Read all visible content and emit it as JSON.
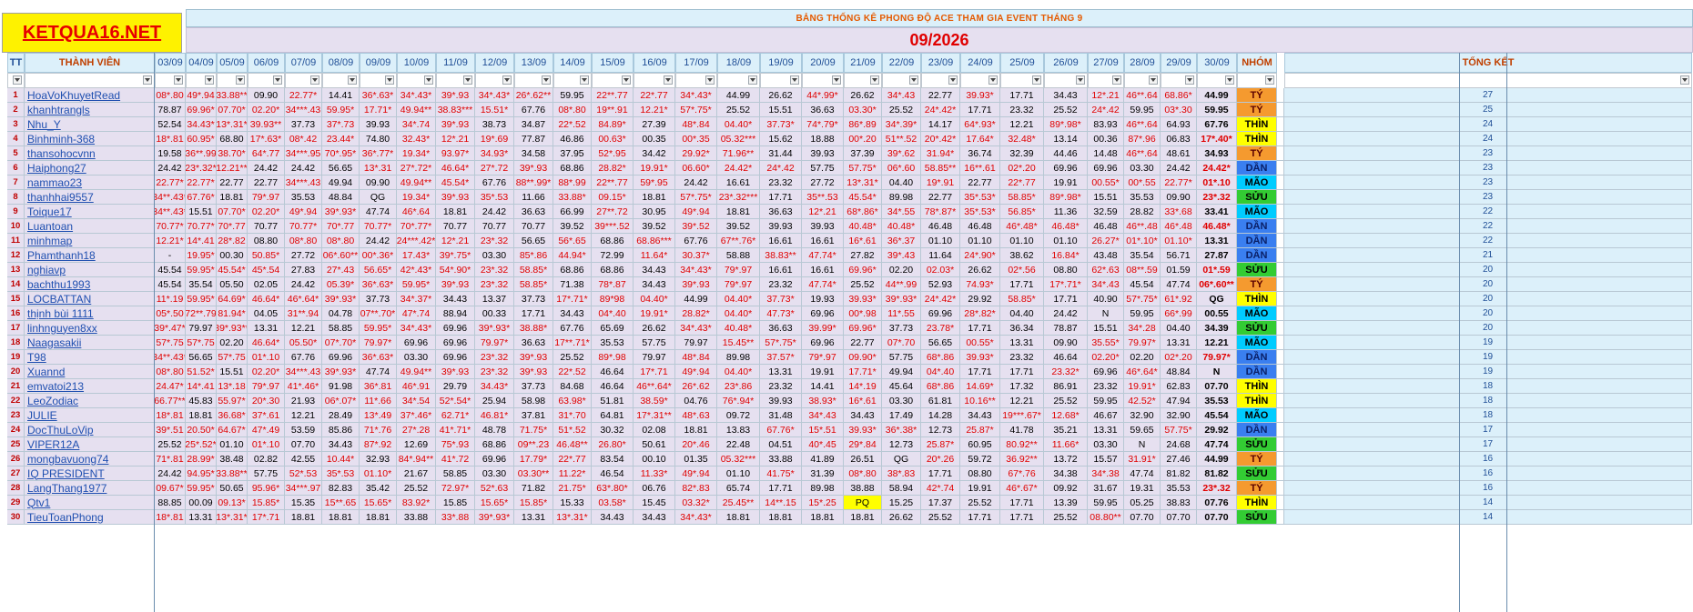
{
  "logo": "KETQUA16.NET",
  "title": "BẢNG THỐNG KÊ PHONG ĐỘ ACE THAM GIA EVENT THÁNG 9",
  "month": "09/2026",
  "headers": {
    "tt": "TT",
    "member": "THÀNH VIÊN",
    "group": "NHÓM",
    "total": "TỔNG KẾT"
  },
  "dates": [
    "03/09",
    "04/09",
    "05/09",
    "06/09",
    "07/09",
    "08/09",
    "09/09",
    "10/09",
    "11/09",
    "12/09",
    "13/09",
    "14/09",
    "15/09",
    "16/09",
    "17/09",
    "18/09",
    "19/09",
    "20/09",
    "21/09",
    "22/09",
    "23/09",
    "24/09",
    "25/09",
    "26/09",
    "27/09",
    "28/09",
    "29/09",
    "30/09"
  ],
  "group_colors": {
    "TÝ": "#f59a2f",
    "THÌN": "#ffff00",
    "DẦN": "#3a7ff0",
    "MÃO": "#00ccff",
    "SỬU": "#33cc33",
    "N": "#ffffff",
    "QG": "#ffffff"
  },
  "rows": [
    {
      "tt": "1",
      "name": "HoaVoKhuyetRead",
      "vals": [
        "08*.80",
        "49*.94",
        "33.88**",
        "09.90",
        "22.77*",
        "14.41",
        "36*.63*",
        "34*.43*",
        "39*.93",
        "34*.43*",
        "26*.62**",
        "59.95",
        "22**.77",
        "22*.77",
        "34*.43*",
        "44.99",
        "26.62",
        "44*.99*",
        "26.62",
        "34*.43",
        "22.77",
        "39.93*",
        "17.71",
        "34.43",
        "12*.21",
        "46**.64",
        "68.86*",
        "44.99"
      ],
      "group": "TÝ",
      "total": "27"
    },
    {
      "tt": "2",
      "name": "khanhtrangls",
      "vals": [
        "78.87",
        "69.96*",
        "07.70*",
        "02.20*",
        "34***.43",
        "59.95*",
        "17.71*",
        "49.94**",
        "38.83***",
        "15.51*",
        "67.76",
        "08*.80",
        "19**.91",
        "12.21*",
        "57*.75*",
        "25.52",
        "15.51",
        "36.63",
        "03.30*",
        "25.52",
        "24*.42*",
        "17.71",
        "23.32",
        "25.52",
        "24*.42",
        "59.95",
        "03*.30",
        "59.95"
      ],
      "group": "TÝ",
      "total": "25"
    },
    {
      "tt": "3",
      "name": "Nhu_Y",
      "vals": [
        "52.54",
        "34.43*",
        "13*.31*",
        "39.93**",
        "37.73",
        "37*.73",
        "39.93",
        "34*.74",
        "39*.93",
        "38.73",
        "34.87",
        "22*.52",
        "84.89*",
        "27.39",
        "48*.84",
        "04.40*",
        "37.73*",
        "74*.79*",
        "86*.89",
        "34*.39*",
        "14.17",
        "64*.93*",
        "12.21",
        "89*.98*",
        "83.93",
        "46**.64",
        "64.93",
        "67.76"
      ],
      "group": "THÌN",
      "total": "24"
    },
    {
      "tt": "4",
      "name": "Binhminh-368",
      "vals": [
        "18*.81",
        "60.95*",
        "68.80",
        "17*.63*",
        "08*.42",
        "23.44*",
        "74.80",
        "32.43*",
        "12*.21",
        "19*.69",
        "77.87",
        "46.86",
        "00.63*",
        "00.35",
        "00*.35",
        "05.32***",
        "15.62",
        "18.88",
        "00*.20",
        "51**.52",
        "20*.42*",
        "17.64*",
        "32.48*",
        "13.14",
        "00.36",
        "87*.96",
        "06.83",
        "17*.40*"
      ],
      "group": "THÌN",
      "total": "24"
    },
    {
      "tt": "5",
      "name": "thansohocvnn",
      "vals": [
        "19.58",
        "36**.99",
        "38.70*",
        "64*.77",
        "34***.95",
        "70*.95*",
        "36*.77*",
        "19.34*",
        "93.97*",
        "34.93*",
        "34.58",
        "37.95",
        "52*.95",
        "34.42",
        "29.92*",
        "71.96**",
        "31.44",
        "39.93",
        "37.39",
        "39*.62",
        "31.94*",
        "36.74",
        "32.39",
        "44.46",
        "14.48",
        "46**.64",
        "48.61",
        "34.93"
      ],
      "group": "TÝ",
      "total": "23"
    },
    {
      "tt": "6",
      "name": "Haiphong27",
      "vals": [
        "24.42",
        "23*.32*",
        "12.21**",
        "24.42",
        "24.42",
        "56.65",
        "13*.31",
        "27*.72*",
        "46.64*",
        "27*.72",
        "39*.93",
        "68.86",
        "28.82*",
        "19.91*",
        "06.60*",
        "24.42*",
        "24*.42",
        "57.75",
        "57.75*",
        "06*.60",
        "58.85**",
        "16**.61",
        "02*.20",
        "69.96",
        "69.96",
        "03.30",
        "24.42",
        "24.42*"
      ],
      "group": "DẦN",
      "total": "23"
    },
    {
      "tt": "7",
      "name": "nammao23",
      "vals": [
        "22.77*",
        "22.77*",
        "22.77",
        "22.77",
        "34***.43",
        "49.94",
        "09.90",
        "49.94**",
        "45.54*",
        "67.76",
        "88**.99*",
        "88*.99",
        "22**.77",
        "59*.95",
        "24.42",
        "16.61",
        "23.32",
        "27.72",
        "13*.31*",
        "04.40",
        "19*.91",
        "22.77",
        "22*.77",
        "19.91",
        "00.55*",
        "00*.55",
        "22.77*",
        "01*.10"
      ],
      "group": "MÃO",
      "total": "23"
    },
    {
      "tt": "8",
      "name": "thanhhai9557",
      "vals": [
        "34**.43*",
        "67.76*",
        "18.81",
        "79*.97",
        "35.53",
        "48.84",
        "QG",
        "19.34*",
        "39*.93",
        "35*.53",
        "11.66",
        "33.88*",
        "09.15*",
        "18.81",
        "57*.75*",
        "23*.32***",
        "17.71",
        "35**.53",
        "45.54*",
        "89.98",
        "22.77",
        "35*.53*",
        "58.85*",
        "89*.98*",
        "15.51",
        "35.53",
        "09.90",
        "23*.32"
      ],
      "group": "SỬU",
      "total": "23"
    },
    {
      "tt": "9",
      "name": "Toique17",
      "vals": [
        "34**.43*",
        "15.51",
        "07.70*",
        "02.20*",
        "49*.94",
        "39*.93*",
        "47.74",
        "46*.64",
        "18.81",
        "24.42",
        "36.63",
        "66.99",
        "27**.72",
        "30.95",
        "49*.94",
        "18.81",
        "36.63",
        "12*.21",
        "68*.86*",
        "34*.55",
        "78*.87*",
        "35*.53*",
        "56.85*",
        "11.36",
        "32.59",
        "28.82",
        "33*.68",
        "33.41"
      ],
      "group": "MÃO",
      "total": "22"
    },
    {
      "tt": "10",
      "name": "Luantoan",
      "vals": [
        "70.77*",
        "70.77*",
        "70*.77",
        "70.77",
        "70.77*",
        "70*.77",
        "70.77*",
        "70*.77*",
        "70.77",
        "70.77",
        "70.77",
        "39.52",
        "39***.52",
        "39.52",
        "39*.52",
        "39.52",
        "39.93",
        "39.93",
        "40.48*",
        "40.48*",
        "46.48",
        "46.48",
        "46*.48*",
        "46.48*",
        "46.48",
        "46**.48",
        "46*.48",
        "46.48*"
      ],
      "group": "DẦN",
      "total": "22"
    },
    {
      "tt": "11",
      "name": "minhmap",
      "vals": [
        "12.21*",
        "14*.41",
        "28*.82",
        "08.80",
        "08*.80",
        "08*.80",
        "24.42",
        "24***.42*",
        "12*.21",
        "23*.32",
        "56.65",
        "56*.65",
        "68.86",
        "68.86***",
        "67.76",
        "67**.76*",
        "16.61",
        "16.61",
        "16*.61",
        "36*.37",
        "01.10",
        "01.10",
        "01.10",
        "01.10",
        "26.27*",
        "01*.10*",
        "01.10*",
        "13.31"
      ],
      "group": "DẦN",
      "total": "22"
    },
    {
      "tt": "12",
      "name": "Phamthanh18",
      "vals": [
        "-",
        "19.95*",
        "00.30",
        "50.85*",
        "27.72",
        "06*.60**",
        "00*.36*",
        "17.43*",
        "39*.75*",
        "03.30",
        "85*.86",
        "44.94*",
        "72.99",
        "11.64*",
        "30.37*",
        "58.88",
        "38.83**",
        "47.74*",
        "27.82",
        "39*.43",
        "11.64",
        "24*.90*",
        "38.62",
        "16.84*",
        "43.48",
        "35.54",
        "56.71",
        "27.87"
      ],
      "group": "DẦN",
      "total": "21"
    },
    {
      "tt": "13",
      "name": "nghiavp",
      "vals": [
        "45.54",
        "59.95*",
        "45.54*",
        "45*.54",
        "27.83",
        "27*.43",
        "56.65*",
        "42*.43*",
        "54*.90*",
        "23*.32",
        "58.85*",
        "68.86",
        "68.86",
        "34.43",
        "34*.43*",
        "79*.97",
        "16.61",
        "16.61",
        "69.96*",
        "02.20",
        "02.03*",
        "26.62",
        "02*.56",
        "08.80",
        "62*.63",
        "08**.59",
        "01.59",
        "01*.59"
      ],
      "group": "SỬU",
      "total": "20"
    },
    {
      "tt": "14",
      "name": "bachthu1993",
      "vals": [
        "45.54",
        "35.54",
        "05.50",
        "02.05",
        "24.42",
        "05.39*",
        "36*.63*",
        "59.95*",
        "39*.93",
        "23*.32",
        "58.85*",
        "71.38",
        "78*.87",
        "34.43",
        "39*.93",
        "79*.97",
        "23.32",
        "47.74*",
        "25.52",
        "44**.99",
        "52.93",
        "74.93*",
        "17.71",
        "17*.71*",
        "34*.43",
        "45.54",
        "47.74",
        "06*.60**"
      ],
      "group": "TÝ",
      "total": "20"
    },
    {
      "tt": "15",
      "name": "LOCBATTAN",
      "vals": [
        "11*.19",
        "59.95*",
        "64.69*",
        "46.64*",
        "46*.64*",
        "39*.93*",
        "37.73",
        "34*.37*",
        "34.43",
        "13.37",
        "37.73",
        "17*.71*",
        "89*98",
        "04.40*",
        "44.99",
        "04.40*",
        "37.73*",
        "19.93",
        "39.93*",
        "39*.93*",
        "24*.42*",
        "29.92",
        "58.85*",
        "17.71",
        "40.90",
        "57*.75*",
        "61*.92",
        "QG"
      ],
      "group": "THÌN",
      "total": "20"
    },
    {
      "tt": "16",
      "name": "thịnh bùi 1111",
      "vals": [
        "05*.50",
        "72**.79",
        "81.94*",
        "04.05",
        "31**.94",
        "04.78",
        "07**.70*",
        "47*.74",
        "88.94",
        "00.33",
        "17.71",
        "34.43",
        "04*.40",
        "19.91*",
        "28.82*",
        "04.40*",
        "47.73*",
        "69.96",
        "00*.98",
        "11*.55",
        "69.96",
        "28*.82*",
        "04.40",
        "24.42",
        "N",
        "59.95",
        "66*.99",
        "00.55"
      ],
      "group": "MÃO",
      "total": "20"
    },
    {
      "tt": "17",
      "name": "linhnguyen8xx",
      "vals": [
        "39*.47*",
        "79.97",
        "39*.93**",
        "13.31",
        "12.21",
        "58.85",
        "59.95*",
        "34*.43*",
        "69.96",
        "39*.93*",
        "38.88*",
        "67.76",
        "65.69",
        "26.62",
        "34*.43*",
        "40.48*",
        "36.63",
        "39.99*",
        "69.96*",
        "37.73",
        "23.78*",
        "17.71",
        "36.34",
        "78.87",
        "15.51",
        "34*.28",
        "04.40",
        "34.39"
      ],
      "group": "SỬU",
      "total": "20"
    },
    {
      "tt": "18",
      "name": "Naagasakii",
      "vals": [
        "57*.75",
        "57*.75",
        "02.20",
        "46.64*",
        "05.50*",
        "07*.70*",
        "79.97*",
        "69.96",
        "69.96",
        "79.97*",
        "36.63",
        "17**.71*",
        "35.53",
        "57.75",
        "79.97",
        "15.45**",
        "57*.75*",
        "69.96",
        "22.77",
        "07*.70",
        "56.65",
        "00.55*",
        "13.31",
        "09.90",
        "35.55*",
        "79.97*",
        "13.31",
        "12.21"
      ],
      "group": "MÃO",
      "total": "19"
    },
    {
      "tt": "19",
      "name": "T98",
      "vals": [
        "34**.43*",
        "56.65",
        "57*.75",
        "01*.10",
        "67.76",
        "69.96",
        "36*.63*",
        "03.30",
        "69.96",
        "23*.32",
        "39*.93",
        "25.52",
        "89*.98",
        "79.97",
        "48*.84",
        "89.98",
        "37.57*",
        "79*.97",
        "09.90*",
        "57.75",
        "68*.86",
        "39.93*",
        "23.32",
        "46.64",
        "02.20*",
        "02.20",
        "02*.20",
        "79.97*"
      ],
      "group": "DẦN",
      "total": "19"
    },
    {
      "tt": "20",
      "name": "Xuannd",
      "vals": [
        "08*.80",
        "51.52*",
        "15.51",
        "02.20*",
        "34***.43",
        "39*.93*",
        "47.74",
        "49.94**",
        "39*.93",
        "23*.32",
        "39*.93",
        "22*.52",
        "46.64",
        "17*.71",
        "49*.94",
        "04.40*",
        "13.31",
        "19.91",
        "17.71*",
        "49.94",
        "04*.40",
        "17.71",
        "17.71",
        "23.32*",
        "69.96",
        "46*.64*",
        "48.84",
        "N"
      ],
      "group": "DẦN",
      "total": "19"
    },
    {
      "tt": "21",
      "name": "emvatoi213",
      "vals": [
        "24.47*",
        "14*.41",
        "13*.18",
        "79*.97",
        "41*.46*",
        "91.98",
        "36*.81",
        "46*.91",
        "29.79",
        "34.43*",
        "37.73",
        "84.68",
        "46.64",
        "46**.64*",
        "26*.62",
        "23*.86",
        "23.32",
        "14.41",
        "14*.19",
        "45.64",
        "68*.86",
        "14.69*",
        "17.32",
        "86.91",
        "23.32",
        "19.91*",
        "62.83",
        "07.70"
      ],
      "group": "THÌN",
      "total": "18"
    },
    {
      "tt": "22",
      "name": "LeoZodiac",
      "vals": [
        "66.77**",
        "45.83",
        "55.97*",
        "20*.30",
        "21.93",
        "06*.07*",
        "11*.66",
        "34*.54",
        "52*.54*",
        "25.94",
        "58.98",
        "63.98*",
        "51.81",
        "38.59*",
        "04.76",
        "76*.94*",
        "39.93",
        "38.93*",
        "16*.61",
        "03.30",
        "61.81",
        "10.16**",
        "12.21",
        "25.52",
        "59.95",
        "42.52*",
        "47.94",
        "35.53"
      ],
      "group": "THÌN",
      "total": "18"
    },
    {
      "tt": "23",
      "name": "JULIE",
      "vals": [
        "18*.81",
        "18.81",
        "36.68*",
        "37*.61",
        "12.21",
        "28.49",
        "13*.49",
        "37*.46*",
        "62.71*",
        "46.81*",
        "37.81",
        "31*.70",
        "64.81",
        "17*.31**",
        "48*.63",
        "09.72",
        "31.48",
        "34*.43",
        "34.43",
        "17.49",
        "14.28",
        "34.43",
        "19***.67*",
        "12.68*",
        "46.67",
        "32.90",
        "32.90",
        "45.54"
      ],
      "group": "MÃO",
      "total": "18"
    },
    {
      "tt": "24",
      "name": "DocThuLoVip",
      "vals": [
        "39*.51",
        "20.50*",
        "64.67*",
        "47*.49",
        "53.59",
        "85.86",
        "71*.76",
        "27*.28",
        "41*.71*",
        "48.78",
        "71.75*",
        "51*.52",
        "30.32",
        "02.08",
        "18.81",
        "13.83",
        "67.76*",
        "15*.51",
        "39.93*",
        "36*.38*",
        "12.73",
        "25.87*",
        "41.78",
        "35.21",
        "13.31",
        "59.65",
        "57.75*",
        "29.92"
      ],
      "group": "DẦN",
      "total": "17"
    },
    {
      "tt": "25",
      "name": "VIPER12A",
      "vals": [
        "25.52",
        "25*.52*",
        "01.10",
        "01*.10",
        "07.70",
        "34.43",
        "87*.92",
        "12.69",
        "75*.93",
        "68.86",
        "09**.23",
        "46.48**",
        "26.80*",
        "50.61",
        "20*.46",
        "22.48",
        "04.51",
        "40*.45",
        "29*.84",
        "12.73",
        "25.87*",
        "60.95",
        "80.92**",
        "11.66*",
        "03.30",
        "N",
        "24.68",
        "47.74"
      ],
      "group": "SỬU",
      "total": "17"
    },
    {
      "tt": "26",
      "name": "mongbavuong74",
      "vals": [
        "71*.81",
        "28.99*",
        "38.48",
        "02.82",
        "42.55",
        "10.44*",
        "32.93",
        "84*.94**",
        "41*.72",
        "69.96",
        "17.79*",
        "22*.77",
        "83.54",
        "00.10",
        "01.35",
        "05.32***",
        "33.88",
        "41.89",
        "26.51",
        "QG",
        "20*.26",
        "59.72",
        "36.92**",
        "13.72",
        "15.57",
        "31.91*",
        "27.46",
        "44.99"
      ],
      "group": "TÝ",
      "total": "16"
    },
    {
      "tt": "27",
      "name": "IQ PRESIDENT",
      "vals": [
        "24.42",
        "94.95*",
        "33.88**",
        "57.75",
        "52*.53",
        "35*.53",
        "01.10*",
        "21.67",
        "58.85",
        "03.30",
        "03.30**",
        "11.22*",
        "46.54",
        "11.33*",
        "49*.94",
        "01.10",
        "41.75*",
        "31.39",
        "08*.80",
        "38*.83",
        "17.71",
        "08.80",
        "67*.76",
        "34.38",
        "34*.38",
        "47.74",
        "81.82",
        "81.82"
      ],
      "group": "SỬU",
      "total": "16"
    },
    {
      "tt": "28",
      "name": "LangThang1977",
      "vals": [
        "09.67*",
        "59.95*",
        "50.65",
        "95.96*",
        "34***.97",
        "82.83",
        "35.42",
        "25.52",
        "72.97*",
        "52*.63",
        "71.82",
        "21.75*",
        "63*.80*",
        "06.76",
        "82*.83",
        "65.74",
        "17.71",
        "89.98",
        "38.88",
        "58.94",
        "42*.74",
        "19.91",
        "46*.67*",
        "09.92",
        "31.67",
        "19.31",
        "35.53",
        "23*.32"
      ],
      "group": "TÝ",
      "total": "16"
    },
    {
      "tt": "29",
      "name": "Qtv1",
      "vals": [
        "88.85",
        "00.09",
        "09.13*",
        "15.85*",
        "15.35",
        "15**.65",
        "15.65*",
        "83.92*",
        "15.85",
        "15.65*",
        "15.85*",
        "15.33",
        "03.58*",
        "15.45",
        "03.32*",
        "25.45**",
        "14**.15",
        "15*.25",
        "PQ",
        "15.25",
        "17.37",
        "25.52",
        "17.71",
        "13.39",
        "59.95",
        "05.25",
        "38.83",
        "07.76"
      ],
      "group": "THÌN",
      "total": "14"
    },
    {
      "tt": "30",
      "name": "TieuToanPhong",
      "vals": [
        "18*.81",
        "13.31",
        "13*.31*",
        "17*.71",
        "18.81",
        "18.81",
        "18.81",
        "33.88",
        "33*.88",
        "39*.93*",
        "13.31",
        "13*.31*",
        "34.43",
        "34.43",
        "34*.43*",
        "18.81",
        "18.81",
        "18.81",
        "18.81",
        "26.62",
        "25.52",
        "17.71",
        "17.71",
        "25.52",
        "08.80**",
        "07.70",
        "07.70",
        "07.70"
      ],
      "group": "SỬU",
      "total": "14"
    }
  ]
}
